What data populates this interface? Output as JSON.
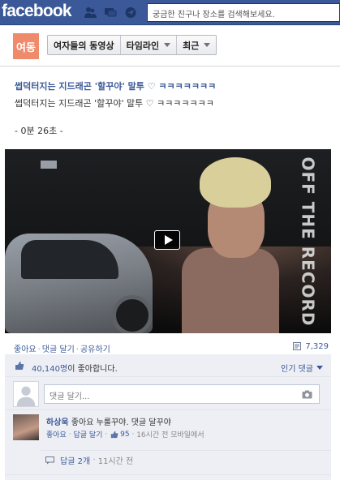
{
  "topbar": {
    "logo": "facebook",
    "search_placeholder": "궁금한 친구나 장소를 검색해보세요.",
    "jewels": [
      "friend-requests-icon",
      "messages-icon",
      "notifications-icon"
    ]
  },
  "page_header": {
    "avatar_text": "여동",
    "crumbs": [
      {
        "label": "여자들의 동영상",
        "has_caret": false
      },
      {
        "label": "타임라인",
        "has_caret": true
      },
      {
        "label": "최근",
        "has_caret": true
      }
    ]
  },
  "post": {
    "title": "썹덕터지는 지드래곤 '할꾸야' 말투 ♡ ㅋㅋㅋㅋㅋㅋㅋ",
    "description": "썹덕터지는 지드래곤 '할꾸야' 말투 ♡ ㅋㅋㅋㅋㅋㅋㅋ",
    "duration": "- 0분 26초 -",
    "video_overlay_text": "OFF THE RECORD",
    "actions": [
      "좋아요",
      "댓글 달기",
      "공유하기"
    ],
    "views": "7,329"
  },
  "ufi": {
    "likes_count": "40,140명",
    "likes_suffix": "이 좋아합니다.",
    "sort_label": "인기 댓글",
    "comment_placeholder": "댓글 달기...",
    "comments": [
      {
        "author": "하상욱",
        "text": "좋아요 누룰꾸야. 댓글 달꾸야",
        "like_label": "좋아요",
        "reply_label": "답글 달기",
        "like_count": "95",
        "time": "16시간 전 모바일에서"
      }
    ],
    "replies_label": "답글 2개",
    "replies_time": "11시간 전"
  },
  "colors": {
    "brand_blue": "#3b5998",
    "page_avatar": "#ef8a6b",
    "ufi_background": "#edeff4"
  }
}
